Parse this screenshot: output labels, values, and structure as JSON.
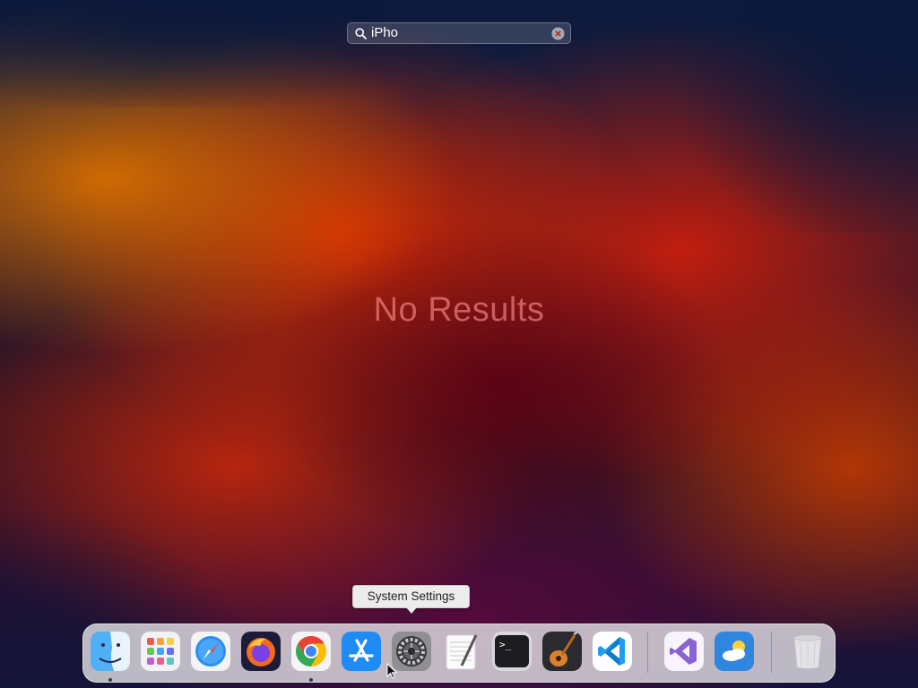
{
  "search": {
    "query": "iPho",
    "icon": "magnifying-glass-icon",
    "clear_icon": "clear-x-icon"
  },
  "results": {
    "empty_message": "No Results"
  },
  "tooltip": {
    "label": "System Settings"
  },
  "dock": {
    "apps": [
      {
        "name": "Finder",
        "icon": "finder-icon",
        "running": true
      },
      {
        "name": "Launchpad",
        "icon": "launchpad-icon",
        "running": false
      },
      {
        "name": "Safari",
        "icon": "safari-compass-icon",
        "running": false
      },
      {
        "name": "Firefox",
        "icon": "firefox-icon",
        "running": false
      },
      {
        "name": "Google Chrome",
        "icon": "chrome-icon",
        "running": true
      },
      {
        "name": "App Store",
        "icon": "app-store-icon",
        "running": false
      },
      {
        "name": "System Settings",
        "icon": "gear-icon",
        "running": false
      },
      {
        "name": "TextEdit",
        "icon": "textedit-icon",
        "running": false
      },
      {
        "name": "Terminal",
        "icon": "terminal-icon",
        "running": false
      },
      {
        "name": "GarageBand",
        "icon": "guitar-icon",
        "running": false
      },
      {
        "name": "Visual Studio Code",
        "icon": "vscode-icon",
        "running": false
      },
      {
        "name": "Visual Studio",
        "icon": "visual-studio-icon",
        "running": false
      },
      {
        "name": "Weather",
        "icon": "weather-icon",
        "running": false
      },
      {
        "name": "Trash",
        "icon": "trash-icon",
        "running": false
      }
    ]
  },
  "colors": {
    "no_results_text": "#ff8c8c",
    "dock_background": "#e8e8ec",
    "tooltip_background": "#ececec"
  }
}
